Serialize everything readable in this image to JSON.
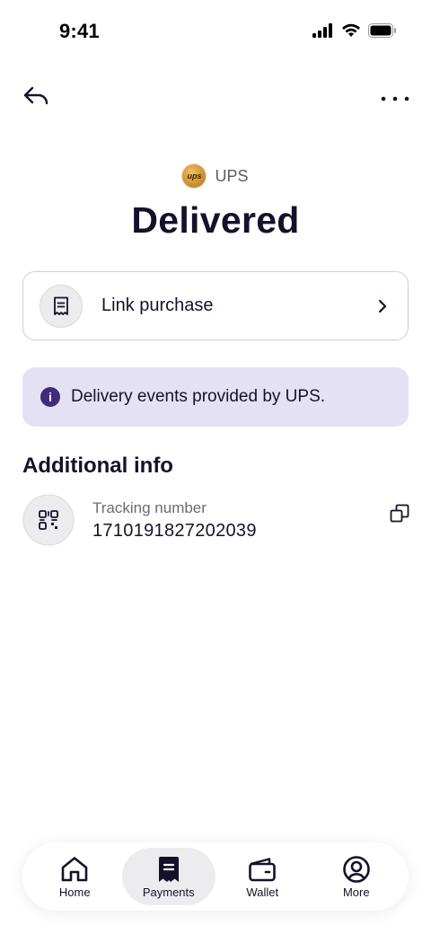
{
  "status_bar": {
    "time": "9:41",
    "icons": [
      "signal-icon",
      "wifi-icon",
      "battery-icon"
    ]
  },
  "nav": {
    "back_icon": "back-arrow-icon",
    "more_icon": "more-dots-icon"
  },
  "carrier": {
    "logo_text": "ups",
    "name": "UPS"
  },
  "delivery_status": "Delivered",
  "link_purchase": {
    "label": "Link purchase",
    "icon": "receipt-icon"
  },
  "info_banner": {
    "text": "Delivery events provided by UPS.",
    "icon_text": "i"
  },
  "additional_info": {
    "title": "Additional info",
    "tracking": {
      "label": "Tracking number",
      "value": "1710191827202039",
      "icon": "qr-code-icon"
    }
  },
  "tabs": [
    {
      "label": "Home",
      "icon": "home-icon",
      "active": false
    },
    {
      "label": "Payments",
      "icon": "payments-icon",
      "active": true
    },
    {
      "label": "Wallet",
      "icon": "wallet-icon",
      "active": false
    },
    {
      "label": "More",
      "icon": "profile-icon",
      "active": false
    }
  ],
  "colors": {
    "text": "#15112b",
    "banner_bg": "#e5e1f4",
    "info_icon": "#3f2c7a",
    "active_tab_bg": "#ececee"
  }
}
